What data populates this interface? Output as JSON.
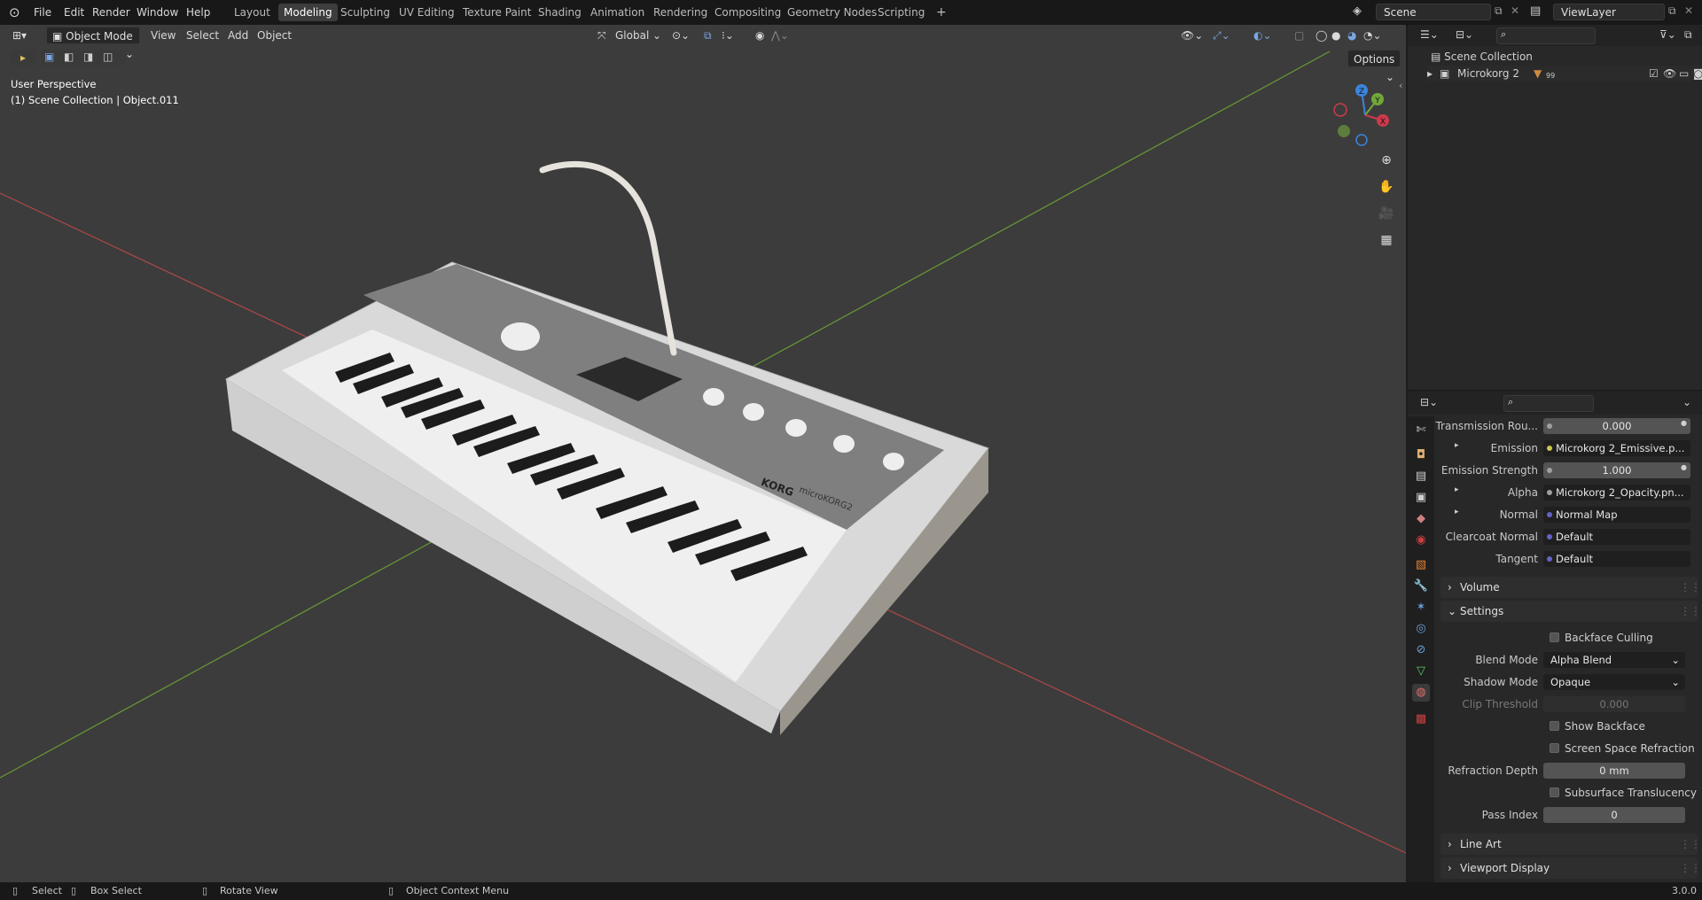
{
  "menu": [
    "File",
    "Edit",
    "Render",
    "Window",
    "Help"
  ],
  "workspaces": [
    "Layout",
    "Modeling",
    "Sculpting",
    "UV Editing",
    "Texture Paint",
    "Shading",
    "Animation",
    "Rendering",
    "Compositing",
    "Geometry Nodes",
    "Scripting"
  ],
  "active_workspace": "Modeling",
  "add_tab": "+",
  "scene": {
    "name": "Scene",
    "view_layer": "ViewLayer"
  },
  "viewport": {
    "mode": "Object Mode",
    "menus": [
      "View",
      "Select",
      "Add",
      "Object"
    ],
    "transform": "Global",
    "options": "Options",
    "info_line1": "User Perspective",
    "info_line2": "(1) Scene Collection | Object.011",
    "gizmo": {
      "z": "Z",
      "y": "Y",
      "x": "X"
    },
    "keyboard_brand": "KORG",
    "keyboard_model": "microKORG2"
  },
  "outliner": {
    "root": "Scene Collection",
    "item": "Microkorg 2",
    "item_badge": "99"
  },
  "properties": {
    "rows": [
      {
        "label": "Transmission Rou...",
        "value": "0.000",
        "kind": "num"
      },
      {
        "label": "Emission",
        "value": "Microkorg 2_Emissive.p...",
        "kind": "link",
        "dot": "#c8c850"
      },
      {
        "label": "Emission Strength",
        "value": "1.000",
        "kind": "num"
      },
      {
        "label": "Alpha",
        "value": "Microkorg 2_Opacity.pn...",
        "kind": "link",
        "dot": "#c8c850"
      },
      {
        "label": "Normal",
        "value": "Normal Map",
        "kind": "link",
        "dot": "#6363c7"
      },
      {
        "label": "Clearcoat Normal",
        "value": "Default",
        "kind": "link",
        "dot": "#6363c7"
      },
      {
        "label": "Tangent",
        "value": "Default",
        "kind": "link",
        "dot": "#6363c7"
      }
    ],
    "volume": "Volume",
    "settings": "Settings",
    "backface_culling": "Backface Culling",
    "blend_mode_label": "Blend Mode",
    "blend_mode": "Alpha Blend",
    "shadow_mode_label": "Shadow Mode",
    "shadow_mode": "Opaque",
    "clip_threshold_label": "Clip Threshold",
    "clip_threshold": "0.000",
    "show_backface": "Show Backface",
    "ssr": "Screen Space Refraction",
    "refraction_depth_label": "Refraction Depth",
    "refraction_depth": "0 mm",
    "subsurface": "Subsurface Translucency",
    "pass_index_label": "Pass Index",
    "pass_index": "0",
    "line_art": "Line Art",
    "viewport_display": "Viewport Display"
  },
  "status": {
    "select": "Select",
    "box_select": "Box Select",
    "rotate": "Rotate View",
    "context": "Object Context Menu",
    "version": "3.0.0"
  },
  "colors": {
    "accent": "#4772b3",
    "x_axis": "#cc3a4c",
    "y_axis": "#71a83a",
    "z_axis": "#3b84dc"
  }
}
